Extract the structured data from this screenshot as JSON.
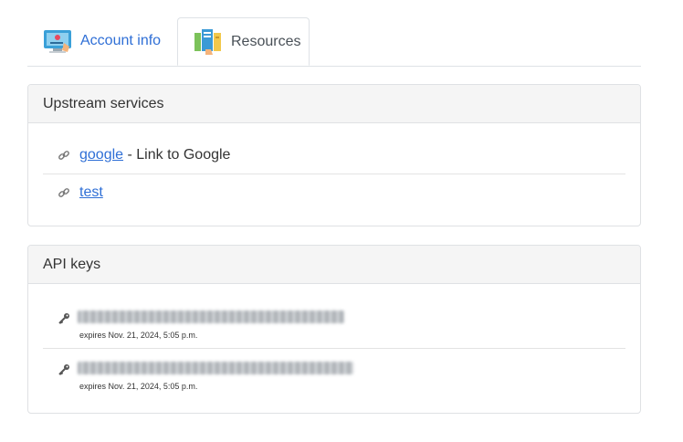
{
  "tabs": [
    {
      "label": "Account info",
      "icon": "account-card-icon",
      "active": false
    },
    {
      "label": "Resources",
      "icon": "resources-books-icon",
      "active": true
    }
  ],
  "upstream": {
    "title": "Upstream services",
    "items": [
      {
        "link": "google",
        "description": " - Link to Google",
        "icon": "link-icon"
      },
      {
        "link": "test",
        "description": "",
        "icon": "link-icon"
      }
    ]
  },
  "api_keys": {
    "title": "API keys",
    "items": [
      {
        "expires": "expires Nov. 21, 2024, 5:05 p.m.",
        "icon": "key-icon"
      },
      {
        "expires": "expires Nov. 21, 2024, 5:05 p.m.",
        "icon": "key-icon"
      }
    ]
  },
  "colors": {
    "link": "#2f6fd6",
    "header_bg": "#f5f5f5",
    "border": "#dfe1e4"
  }
}
